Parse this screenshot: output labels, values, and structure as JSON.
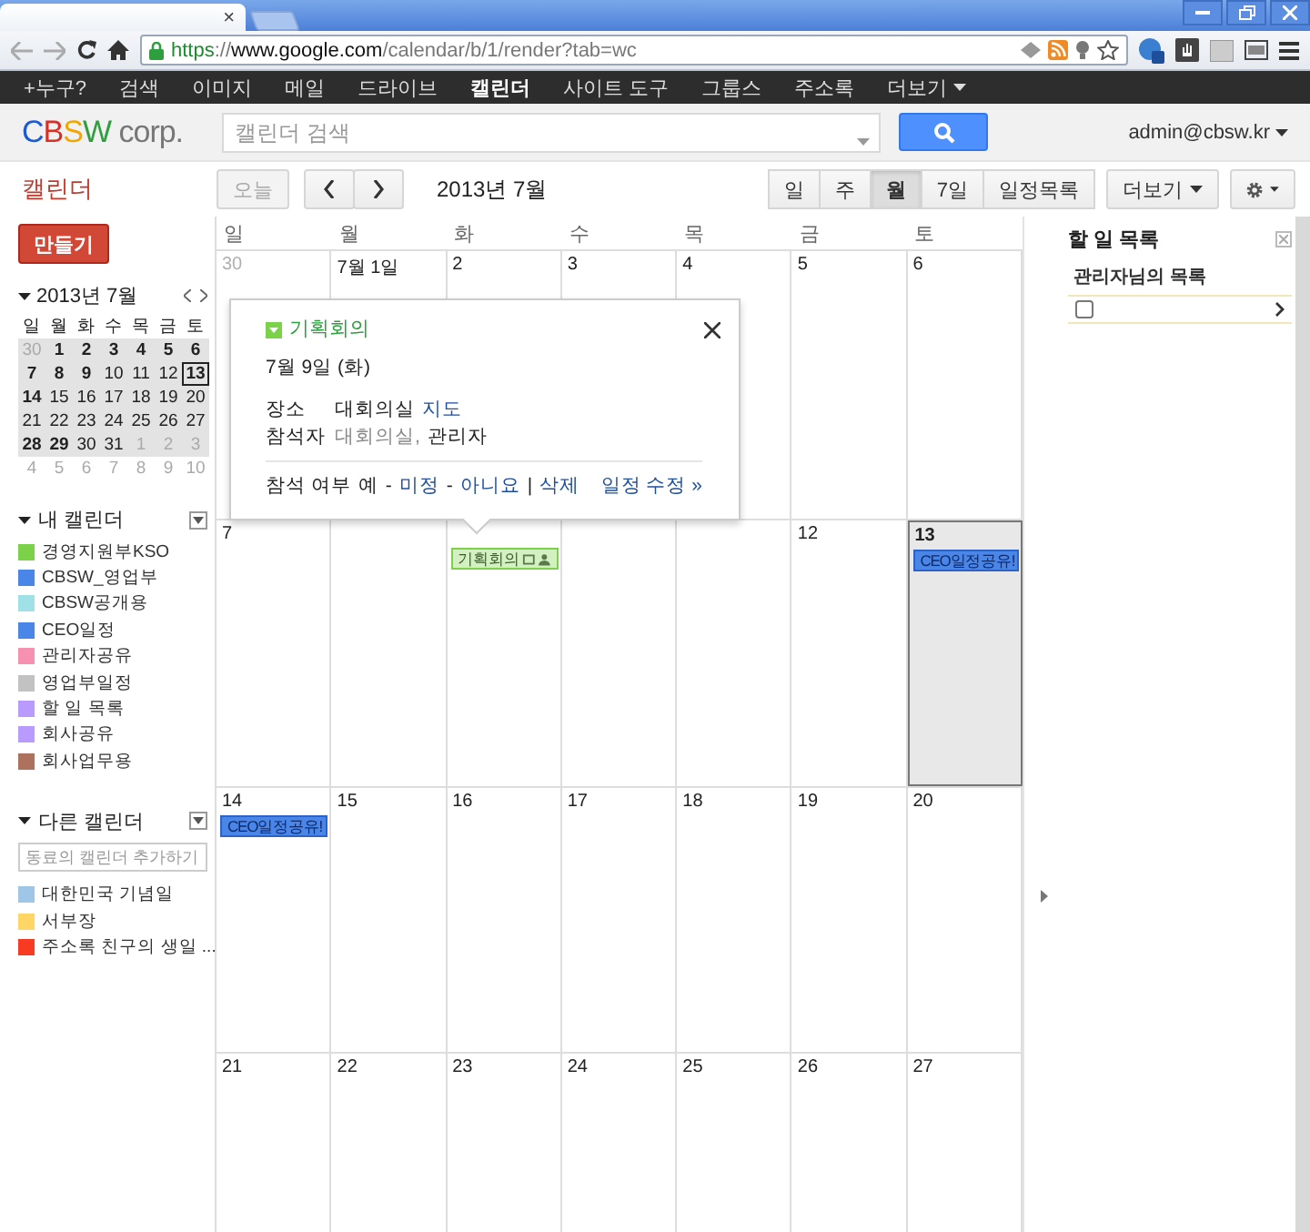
{
  "browser": {
    "tab": {
      "close": "×",
      "selected": true
    },
    "url": {
      "scheme": "https",
      "sep": "://",
      "host": "www.google.com",
      "path": "/calendar/b/1/render?tab=wc"
    }
  },
  "google_bar": [
    {
      "label": "+누구?",
      "selected": false
    },
    {
      "label": "검색",
      "selected": false
    },
    {
      "label": "이미지",
      "selected": false
    },
    {
      "label": "메일",
      "selected": false
    },
    {
      "label": "드라이브",
      "selected": false
    },
    {
      "label": "캘린더",
      "selected": true
    },
    {
      "label": "사이트 도구",
      "selected": false
    },
    {
      "label": "그룹스",
      "selected": false
    },
    {
      "label": "주소록",
      "selected": false
    },
    {
      "label": "더보기",
      "selected": false,
      "kind": "menu"
    }
  ],
  "header": {
    "logo": [
      {
        "text": "C",
        "color": "#1c5bd1"
      },
      {
        "text": "B",
        "color": "#d93025"
      },
      {
        "text": "S",
        "color": "#f2a600"
      },
      {
        "text": "W",
        "color": "#2e9e3e"
      },
      {
        "text": " corp.",
        "color": "#777777"
      }
    ],
    "search_placeholder": "캘린더 검색",
    "account": "admin@cbsw.kr"
  },
  "toolbar": {
    "app_title": "캘린더",
    "today": {
      "label": "오늘",
      "disabled": true
    },
    "period": "2013년 7월",
    "views": [
      {
        "label": "일",
        "selected": false
      },
      {
        "label": "주",
        "selected": false
      },
      {
        "label": "월",
        "selected": true
      },
      {
        "label": "7일",
        "selected": false
      },
      {
        "label": "일정목록",
        "selected": false
      }
    ],
    "more": "더보기"
  },
  "sidebar": {
    "create": "만들기",
    "mini_calendar": {
      "title": "2013년 7월",
      "weekdays": [
        "일",
        "월",
        "화",
        "수",
        "목",
        "금",
        "토"
      ],
      "weeks": [
        [
          {
            "day": "30",
            "muted": true,
            "in_view": true,
            "bold": false,
            "today": false
          },
          {
            "day": "1",
            "muted": false,
            "in_view": true,
            "bold": true,
            "today": false
          },
          {
            "day": "2",
            "muted": false,
            "in_view": true,
            "bold": true,
            "today": false
          },
          {
            "day": "3",
            "muted": false,
            "in_view": true,
            "bold": true,
            "today": false
          },
          {
            "day": "4",
            "muted": false,
            "in_view": true,
            "bold": true,
            "today": false
          },
          {
            "day": "5",
            "muted": false,
            "in_view": true,
            "bold": true,
            "today": false
          },
          {
            "day": "6",
            "muted": false,
            "in_view": true,
            "bold": true,
            "today": false
          }
        ],
        [
          {
            "day": "7",
            "muted": false,
            "in_view": true,
            "bold": true,
            "today": false
          },
          {
            "day": "8",
            "muted": false,
            "in_view": true,
            "bold": true,
            "today": false
          },
          {
            "day": "9",
            "muted": false,
            "in_view": true,
            "bold": true,
            "today": false
          },
          {
            "day": "10",
            "muted": false,
            "in_view": true,
            "bold": false,
            "today": false
          },
          {
            "day": "11",
            "muted": false,
            "in_view": true,
            "bold": false,
            "today": false
          },
          {
            "day": "12",
            "muted": false,
            "in_view": true,
            "bold": false,
            "today": false
          },
          {
            "day": "13",
            "muted": false,
            "in_view": true,
            "bold": true,
            "today": true
          }
        ],
        [
          {
            "day": "14",
            "muted": false,
            "in_view": true,
            "bold": true,
            "today": false
          },
          {
            "day": "15",
            "muted": false,
            "in_view": true,
            "bold": false,
            "today": false
          },
          {
            "day": "16",
            "muted": false,
            "in_view": true,
            "bold": false,
            "today": false
          },
          {
            "day": "17",
            "muted": false,
            "in_view": true,
            "bold": false,
            "today": false
          },
          {
            "day": "18",
            "muted": false,
            "in_view": true,
            "bold": false,
            "today": false
          },
          {
            "day": "19",
            "muted": false,
            "in_view": true,
            "bold": false,
            "today": false
          },
          {
            "day": "20",
            "muted": false,
            "in_view": true,
            "bold": false,
            "today": false
          }
        ],
        [
          {
            "day": "21",
            "muted": false,
            "in_view": true,
            "bold": false,
            "today": false
          },
          {
            "day": "22",
            "muted": false,
            "in_view": true,
            "bold": false,
            "today": false
          },
          {
            "day": "23",
            "muted": false,
            "in_view": true,
            "bold": false,
            "today": false
          },
          {
            "day": "24",
            "muted": false,
            "in_view": true,
            "bold": false,
            "today": false
          },
          {
            "day": "25",
            "muted": false,
            "in_view": true,
            "bold": false,
            "today": false
          },
          {
            "day": "26",
            "muted": false,
            "in_view": true,
            "bold": false,
            "today": false
          },
          {
            "day": "27",
            "muted": false,
            "in_view": true,
            "bold": false,
            "today": false
          }
        ],
        [
          {
            "day": "28",
            "muted": false,
            "in_view": true,
            "bold": true,
            "today": false
          },
          {
            "day": "29",
            "muted": false,
            "in_view": true,
            "bold": true,
            "today": false
          },
          {
            "day": "30",
            "muted": false,
            "in_view": true,
            "bold": false,
            "today": false
          },
          {
            "day": "31",
            "muted": false,
            "in_view": true,
            "bold": false,
            "today": false
          },
          {
            "day": "1",
            "muted": true,
            "in_view": true,
            "bold": false,
            "today": false
          },
          {
            "day": "2",
            "muted": true,
            "in_view": true,
            "bold": false,
            "today": false
          },
          {
            "day": "3",
            "muted": true,
            "in_view": true,
            "bold": false,
            "today": false
          }
        ],
        [
          {
            "day": "4",
            "muted": true,
            "in_view": false,
            "bold": false,
            "today": false
          },
          {
            "day": "5",
            "muted": true,
            "in_view": false,
            "bold": false,
            "today": false
          },
          {
            "day": "6",
            "muted": true,
            "in_view": false,
            "bold": false,
            "today": false
          },
          {
            "day": "7",
            "muted": true,
            "in_view": false,
            "bold": false,
            "today": false
          },
          {
            "day": "8",
            "muted": true,
            "in_view": false,
            "bold": false,
            "today": false
          },
          {
            "day": "9",
            "muted": true,
            "in_view": false,
            "bold": false,
            "today": false
          },
          {
            "day": "10",
            "muted": true,
            "in_view": false,
            "bold": false,
            "today": false
          }
        ]
      ]
    },
    "my_calendars": {
      "title": "내 캘린더",
      "items": [
        {
          "name": "경영지원부KSO",
          "color": "#7bd148"
        },
        {
          "name": "CBSW_영업부",
          "color": "#4986e7"
        },
        {
          "name": "CBSW공개용",
          "color": "#9fe1e7"
        },
        {
          "name": "CEO일정",
          "color": "#4986e7"
        },
        {
          "name": "관리자공유",
          "color": "#f691b2"
        },
        {
          "name": "영업부일정",
          "color": "#c2c2c2"
        },
        {
          "name": "할 일 목록",
          "color": "#b99aff"
        },
        {
          "name": "회사공유",
          "color": "#b99aff"
        },
        {
          "name": "회사업무용",
          "color": "#ac725e"
        }
      ]
    },
    "other_calendars": {
      "title": "다른 캘린더",
      "placeholder": "동료의 캘린더 추가하기",
      "items": [
        {
          "name": "대한민국 기념일",
          "color": "#9fc6e7"
        },
        {
          "name": "서부장",
          "color": "#ffd666"
        },
        {
          "name": "주소록 친구의 생일 ...",
          "color": "#f83a22"
        }
      ]
    }
  },
  "calendar": {
    "weekdays": [
      "일",
      "월",
      "화",
      "수",
      "목",
      "금",
      "토"
    ],
    "weeks": [
      {
        "days": [
          {
            "label": "30",
            "muted": true,
            "today": false
          },
          {
            "label": "7월 1일",
            "muted": false,
            "today": false
          },
          {
            "label": "2",
            "muted": false,
            "today": false
          },
          {
            "label": "3",
            "muted": false,
            "today": false
          },
          {
            "label": "4",
            "muted": false,
            "today": false
          },
          {
            "label": "5",
            "muted": false,
            "today": false
          },
          {
            "label": "6",
            "muted": false,
            "today": false
          }
        ]
      },
      {
        "days": [
          {
            "label": "7",
            "muted": false,
            "today": false
          },
          {
            "today": false
          },
          {
            "today": false,
            "events": [
              {
                "title": "기획회의",
                "kind": "outlined",
                "color": "#7bd148"
              }
            ]
          },
          {
            "today": false
          },
          {
            "today": false
          },
          {
            "label": "12",
            "muted": false,
            "today": false
          },
          {
            "label": "13",
            "muted": false,
            "today": true,
            "events": [
              {
                "title": "CEO일정공유!",
                "kind": "filled",
                "color": "#4986e7"
              }
            ]
          }
        ]
      },
      {
        "days": [
          {
            "label": "14",
            "muted": false,
            "today": false,
            "events": [
              {
                "title": "CEO일정공유!",
                "kind": "filled",
                "color": "#4986e7"
              }
            ]
          },
          {
            "label": "15",
            "muted": false,
            "today": false
          },
          {
            "label": "16",
            "muted": false,
            "today": false
          },
          {
            "label": "17",
            "muted": false,
            "today": false
          },
          {
            "label": "18",
            "muted": false,
            "today": false
          },
          {
            "label": "19",
            "muted": false,
            "today": false
          },
          {
            "label": "20",
            "muted": false,
            "today": false
          }
        ]
      },
      {
        "days": [
          {
            "label": "21",
            "muted": false,
            "today": false
          },
          {
            "label": "22",
            "muted": false,
            "today": false
          },
          {
            "label": "23",
            "muted": false,
            "today": false
          },
          {
            "label": "24",
            "muted": false,
            "today": false
          },
          {
            "label": "25",
            "muted": false,
            "today": false
          },
          {
            "label": "26",
            "muted": false,
            "today": false
          },
          {
            "label": "27",
            "muted": false,
            "today": false
          }
        ]
      }
    ]
  },
  "popup": {
    "title": "기획회의",
    "date": "7월 9일 (화)",
    "rows": [
      {
        "label": "장소",
        "values": [
          {
            "text": "대회의실",
            "kind": "plain"
          },
          {
            "text": "지도",
            "kind": "link"
          }
        ]
      },
      {
        "label": "참석자",
        "values": [
          {
            "text": "대회의실,",
            "kind": "muted"
          },
          {
            "text": "관리자",
            "kind": "plain"
          }
        ]
      }
    ],
    "rsvp_label": "참석 여부",
    "actions": [
      {
        "kind": "option",
        "text": "예",
        "selected": true
      },
      {
        "kind": "sep",
        "text": "-"
      },
      {
        "kind": "option",
        "text": "미정",
        "selected": false
      },
      {
        "kind": "sep",
        "text": "-"
      },
      {
        "kind": "option",
        "text": "아니요",
        "selected": false
      },
      {
        "kind": "sep",
        "text": "|"
      },
      {
        "kind": "link",
        "text": "삭제"
      }
    ],
    "edit": "일정 수정 »"
  },
  "tasks": {
    "title": "할 일 목록",
    "list_name": "관리자님의 목록",
    "items": [
      {
        "checked": false
      }
    ]
  }
}
